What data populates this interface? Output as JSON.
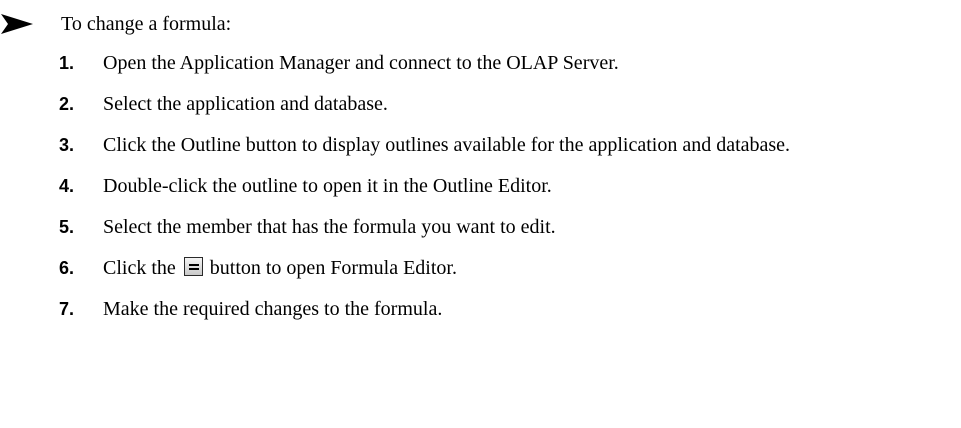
{
  "intro": {
    "arrow": "arrowhead-icon",
    "text": "To change a formula:"
  },
  "steps": [
    {
      "number": "1.",
      "text": "Open the Application Manager and connect to the OLAP Server."
    },
    {
      "number": "2.",
      "text": "Select the application and database."
    },
    {
      "number": "3.",
      "text": "Click the Outline button to display outlines available for the application and database."
    },
    {
      "number": "4.",
      "text": "Double-click the outline to open it in the Outline Editor."
    },
    {
      "number": "5.",
      "text": "Select the member that has the formula you want to edit."
    },
    {
      "number": "6.",
      "prefix": "Click the",
      "icon": "equals-button-icon",
      "suffix": "button to open Formula Editor."
    },
    {
      "number": "7.",
      "text": "Make the required changes to the formula."
    }
  ]
}
